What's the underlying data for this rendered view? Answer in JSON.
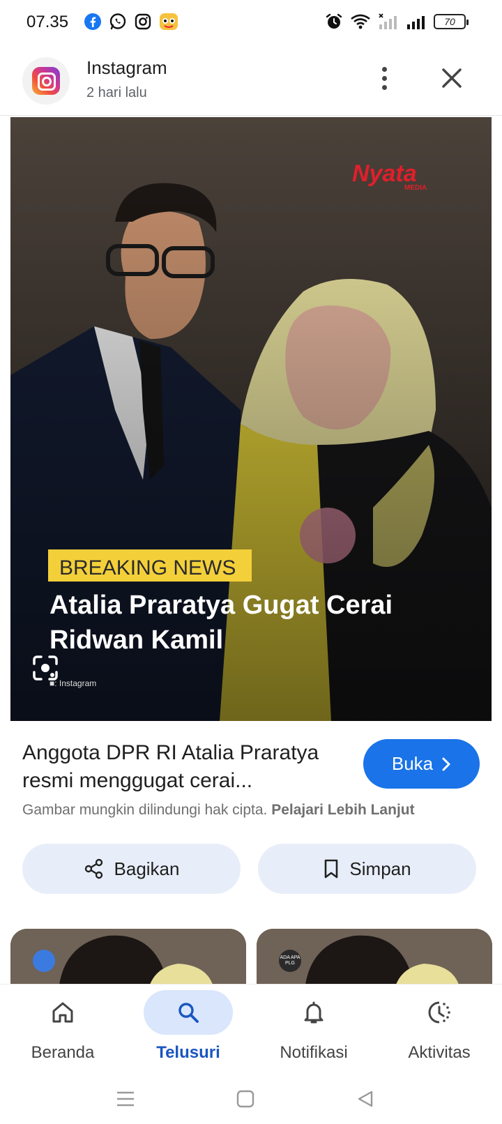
{
  "status_bar": {
    "time": "07.35",
    "app_icons": [
      "facebook-icon",
      "whatsapp-icon",
      "instagram-icon",
      "news-app-icon"
    ],
    "battery": "70"
  },
  "header": {
    "source_name": "Instagram",
    "source_time": "2 hari lalu"
  },
  "image": {
    "brand": "Nyata",
    "brand_sub": "MEDIA",
    "badge": "BREAKING NEWS",
    "headline_line1": "Atalia Praratya Gugat Cerai",
    "headline_line2": "Ridwan Kamil",
    "credit": "■: Instagram"
  },
  "result": {
    "title": "Anggota DPR RI Atalia Praratya resmi menggugat cerai...",
    "open_label": "Buka",
    "copyright_text": "Gambar mungkin dilindungi hak cipta.",
    "learn_more": "Pelajari Lebih Lanjut"
  },
  "actions": {
    "share_label": "Bagikan",
    "save_label": "Simpan"
  },
  "related": {
    "thumb2_badge": "ADA APA PLG"
  },
  "bottom_nav": {
    "items": [
      {
        "label": "Beranda",
        "icon": "home-icon"
      },
      {
        "label": "Telusuri",
        "icon": "search-icon",
        "active": true
      },
      {
        "label": "Notifikasi",
        "icon": "bell-icon"
      },
      {
        "label": "Aktivitas",
        "icon": "history-icon"
      }
    ]
  },
  "colors": {
    "accent": "#1a73e8",
    "active_nav": "#1a56c0",
    "badge_yellow": "#f3d03a"
  }
}
